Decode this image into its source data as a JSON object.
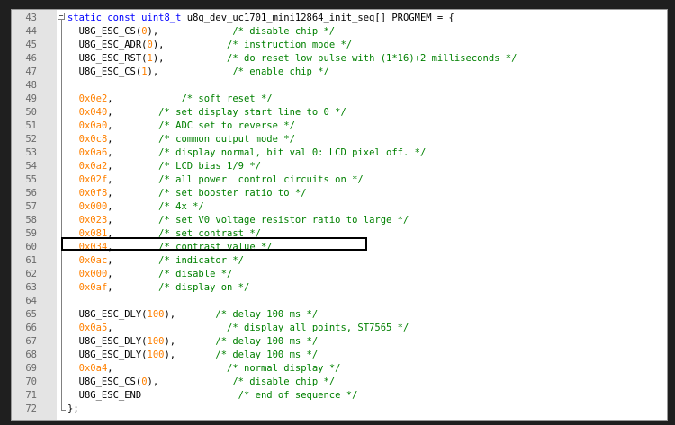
{
  "editor": {
    "highlighted_line": 60,
    "lines": [
      {
        "n": "43",
        "tokens": [
          {
            "t": "static const uint8_t ",
            "c": "kw"
          },
          {
            "t": "u8g_dev_uc1701_mini12864_init_seq[] PROGMEM = {",
            "c": "def"
          }
        ]
      },
      {
        "n": "44",
        "tokens": [
          {
            "t": "  U8G_ESC_CS(",
            "c": "def"
          },
          {
            "t": "0",
            "c": "num"
          },
          {
            "t": "),             ",
            "c": "def"
          },
          {
            "t": "/* disable chip */",
            "c": "cm"
          }
        ]
      },
      {
        "n": "45",
        "tokens": [
          {
            "t": "  U8G_ESC_ADR(",
            "c": "def"
          },
          {
            "t": "0",
            "c": "num"
          },
          {
            "t": "),           ",
            "c": "def"
          },
          {
            "t": "/* instruction mode */",
            "c": "cm"
          }
        ]
      },
      {
        "n": "46",
        "tokens": [
          {
            "t": "  U8G_ESC_RST(",
            "c": "def"
          },
          {
            "t": "1",
            "c": "num"
          },
          {
            "t": "),           ",
            "c": "def"
          },
          {
            "t": "/* do reset low pulse with (1*16)+2 milliseconds */",
            "c": "cm"
          }
        ]
      },
      {
        "n": "47",
        "tokens": [
          {
            "t": "  U8G_ESC_CS(",
            "c": "def"
          },
          {
            "t": "1",
            "c": "num"
          },
          {
            "t": "),             ",
            "c": "def"
          },
          {
            "t": "/* enable chip */",
            "c": "cm"
          }
        ]
      },
      {
        "n": "48",
        "tokens": []
      },
      {
        "n": "49",
        "tokens": [
          {
            "t": "  ",
            "c": "def"
          },
          {
            "t": "0x0e2",
            "c": "num"
          },
          {
            "t": ",            ",
            "c": "def"
          },
          {
            "t": "/* soft reset */",
            "c": "cm"
          }
        ]
      },
      {
        "n": "50",
        "tokens": [
          {
            "t": "  ",
            "c": "def"
          },
          {
            "t": "0x040",
            "c": "num"
          },
          {
            "t": ",        ",
            "c": "def"
          },
          {
            "t": "/* set display start line to 0 */",
            "c": "cm"
          }
        ]
      },
      {
        "n": "51",
        "tokens": [
          {
            "t": "  ",
            "c": "def"
          },
          {
            "t": "0x0a0",
            "c": "num"
          },
          {
            "t": ",        ",
            "c": "def"
          },
          {
            "t": "/* ADC set to reverse */",
            "c": "cm"
          }
        ]
      },
      {
        "n": "52",
        "tokens": [
          {
            "t": "  ",
            "c": "def"
          },
          {
            "t": "0x0c8",
            "c": "num"
          },
          {
            "t": ",        ",
            "c": "def"
          },
          {
            "t": "/* common output mode */",
            "c": "cm"
          }
        ]
      },
      {
        "n": "53",
        "tokens": [
          {
            "t": "  ",
            "c": "def"
          },
          {
            "t": "0x0a6",
            "c": "num"
          },
          {
            "t": ",        ",
            "c": "def"
          },
          {
            "t": "/* display normal, bit val 0: LCD pixel off. */",
            "c": "cm"
          }
        ]
      },
      {
        "n": "54",
        "tokens": [
          {
            "t": "  ",
            "c": "def"
          },
          {
            "t": "0x0a2",
            "c": "num"
          },
          {
            "t": ",        ",
            "c": "def"
          },
          {
            "t": "/* LCD bias 1/9 */",
            "c": "cm"
          }
        ]
      },
      {
        "n": "55",
        "tokens": [
          {
            "t": "  ",
            "c": "def"
          },
          {
            "t": "0x02f",
            "c": "num"
          },
          {
            "t": ",        ",
            "c": "def"
          },
          {
            "t": "/* all power  control circuits on */",
            "c": "cm"
          }
        ]
      },
      {
        "n": "56",
        "tokens": [
          {
            "t": "  ",
            "c": "def"
          },
          {
            "t": "0x0f8",
            "c": "num"
          },
          {
            "t": ",        ",
            "c": "def"
          },
          {
            "t": "/* set booster ratio to */",
            "c": "cm"
          }
        ]
      },
      {
        "n": "57",
        "tokens": [
          {
            "t": "  ",
            "c": "def"
          },
          {
            "t": "0x000",
            "c": "num"
          },
          {
            "t": ",        ",
            "c": "def"
          },
          {
            "t": "/* 4x */",
            "c": "cm"
          }
        ]
      },
      {
        "n": "58",
        "tokens": [
          {
            "t": "  ",
            "c": "def"
          },
          {
            "t": "0x023",
            "c": "num"
          },
          {
            "t": ",        ",
            "c": "def"
          },
          {
            "t": "/* set V0 voltage resistor ratio to large */",
            "c": "cm"
          }
        ]
      },
      {
        "n": "59",
        "tokens": [
          {
            "t": "  ",
            "c": "def"
          },
          {
            "t": "0x081",
            "c": "num"
          },
          {
            "t": ",        ",
            "c": "def"
          },
          {
            "t": "/* set contrast */",
            "c": "cm"
          }
        ]
      },
      {
        "n": "60",
        "tokens": [
          {
            "t": "  ",
            "c": "def"
          },
          {
            "t": "0x034",
            "c": "num"
          },
          {
            "t": ",        ",
            "c": "def"
          },
          {
            "t": "/* contrast value */",
            "c": "cm"
          }
        ]
      },
      {
        "n": "61",
        "tokens": [
          {
            "t": "  ",
            "c": "def"
          },
          {
            "t": "0x0ac",
            "c": "num"
          },
          {
            "t": ",        ",
            "c": "def"
          },
          {
            "t": "/* indicator */",
            "c": "cm"
          }
        ]
      },
      {
        "n": "62",
        "tokens": [
          {
            "t": "  ",
            "c": "def"
          },
          {
            "t": "0x000",
            "c": "num"
          },
          {
            "t": ",        ",
            "c": "def"
          },
          {
            "t": "/* disable */",
            "c": "cm"
          }
        ]
      },
      {
        "n": "63",
        "tokens": [
          {
            "t": "  ",
            "c": "def"
          },
          {
            "t": "0x0af",
            "c": "num"
          },
          {
            "t": ",        ",
            "c": "def"
          },
          {
            "t": "/* display on */",
            "c": "cm"
          }
        ]
      },
      {
        "n": "64",
        "tokens": []
      },
      {
        "n": "65",
        "tokens": [
          {
            "t": "  U8G_ESC_DLY(",
            "c": "def"
          },
          {
            "t": "100",
            "c": "num"
          },
          {
            "t": "),       ",
            "c": "def"
          },
          {
            "t": "/* delay 100 ms */",
            "c": "cm"
          }
        ]
      },
      {
        "n": "66",
        "tokens": [
          {
            "t": "  ",
            "c": "def"
          },
          {
            "t": "0x0a5",
            "c": "num"
          },
          {
            "t": ",                    ",
            "c": "def"
          },
          {
            "t": "/* display all points, ST7565 */",
            "c": "cm"
          }
        ]
      },
      {
        "n": "67",
        "tokens": [
          {
            "t": "  U8G_ESC_DLY(",
            "c": "def"
          },
          {
            "t": "100",
            "c": "num"
          },
          {
            "t": "),       ",
            "c": "def"
          },
          {
            "t": "/* delay 100 ms */",
            "c": "cm"
          }
        ]
      },
      {
        "n": "68",
        "tokens": [
          {
            "t": "  U8G_ESC_DLY(",
            "c": "def"
          },
          {
            "t": "100",
            "c": "num"
          },
          {
            "t": "),       ",
            "c": "def"
          },
          {
            "t": "/* delay 100 ms */",
            "c": "cm"
          }
        ]
      },
      {
        "n": "69",
        "tokens": [
          {
            "t": "  ",
            "c": "def"
          },
          {
            "t": "0x0a4",
            "c": "num"
          },
          {
            "t": ",                    ",
            "c": "def"
          },
          {
            "t": "/* normal display */",
            "c": "cm"
          }
        ]
      },
      {
        "n": "70",
        "tokens": [
          {
            "t": "  U8G_ESC_CS(",
            "c": "def"
          },
          {
            "t": "0",
            "c": "num"
          },
          {
            "t": "),             ",
            "c": "def"
          },
          {
            "t": "/* disable chip */",
            "c": "cm"
          }
        ]
      },
      {
        "n": "71",
        "tokens": [
          {
            "t": "  U8G_ESC_END                 ",
            "c": "def"
          },
          {
            "t": "/* end of sequence */",
            "c": "cm"
          }
        ]
      },
      {
        "n": "72",
        "tokens": [
          {
            "t": "};",
            "c": "def"
          }
        ]
      }
    ]
  }
}
